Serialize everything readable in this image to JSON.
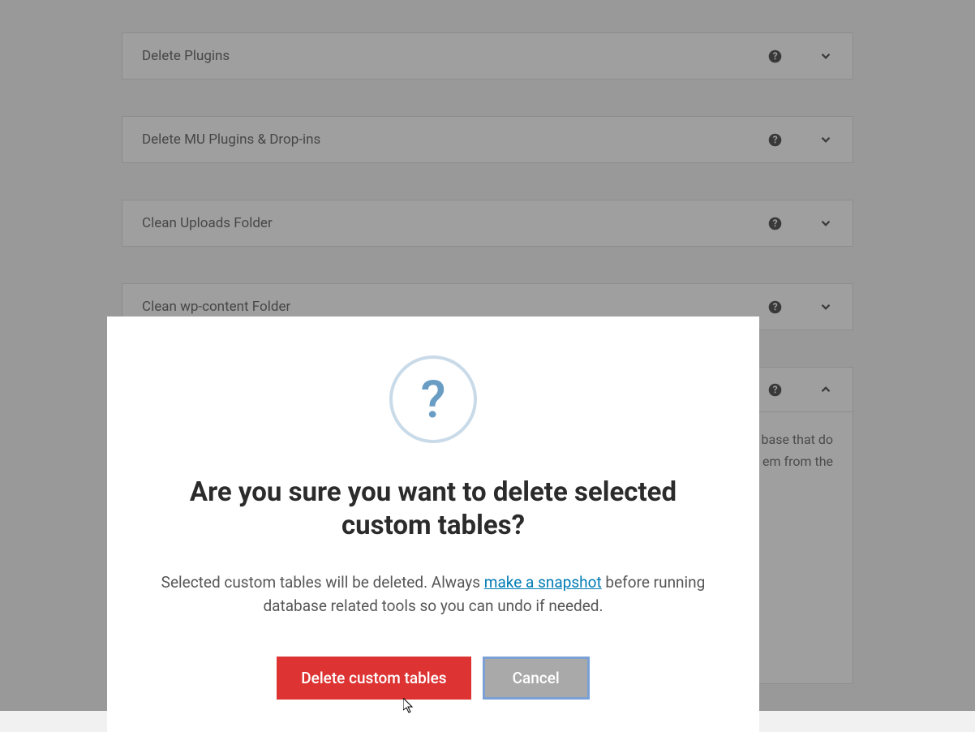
{
  "panels": [
    {
      "title": "Delete Plugins",
      "expanded": false
    },
    {
      "title": "Delete MU Plugins & Drop-ins",
      "expanded": false
    },
    {
      "title": "Clean Uploads Folder",
      "expanded": false
    },
    {
      "title": "Clean wp-content Folder",
      "expanded": false
    }
  ],
  "expanded_panel": {
    "description_fragment1": "base that do",
    "description_fragment2": "em from the"
  },
  "modal": {
    "icon_char": "?",
    "title": "Are you sure you want to delete selected custom tables?",
    "desc_before": "Selected custom tables will be deleted. Always ",
    "desc_link": "make a snapshot",
    "desc_after": " before running database related tools so you can undo if needed.",
    "confirm_label": "Delete custom tables",
    "cancel_label": "Cancel"
  }
}
